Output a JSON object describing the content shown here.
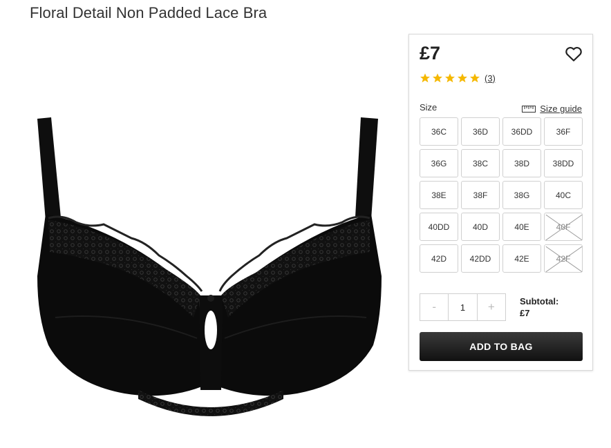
{
  "product": {
    "title": "Floral Detail Non Padded Lace Bra",
    "price": "£7",
    "rating_stars": 5,
    "review_count": "(3)"
  },
  "size": {
    "label": "Size",
    "guide_label": "Size guide",
    "options": [
      {
        "label": "36C",
        "available": true
      },
      {
        "label": "36D",
        "available": true
      },
      {
        "label": "36DD",
        "available": true
      },
      {
        "label": "36F",
        "available": true
      },
      {
        "label": "36G",
        "available": true
      },
      {
        "label": "38C",
        "available": true
      },
      {
        "label": "38D",
        "available": true
      },
      {
        "label": "38DD",
        "available": true
      },
      {
        "label": "38E",
        "available": true
      },
      {
        "label": "38F",
        "available": true
      },
      {
        "label": "38G",
        "available": true
      },
      {
        "label": "40C",
        "available": true
      },
      {
        "label": "40DD",
        "available": true
      },
      {
        "label": "40D",
        "available": true
      },
      {
        "label": "40E",
        "available": true
      },
      {
        "label": "40F",
        "available": false
      },
      {
        "label": "42D",
        "available": true
      },
      {
        "label": "42DD",
        "available": true
      },
      {
        "label": "42E",
        "available": true
      },
      {
        "label": "42F",
        "available": false
      }
    ]
  },
  "quantity": {
    "decrement": "-",
    "value": "1",
    "increment": "+"
  },
  "subtotal": {
    "label": "Subtotal:",
    "value": "£7"
  },
  "cart": {
    "add_label": "ADD TO BAG"
  },
  "colors": {
    "star": "#f5b800",
    "button_dark": "#1a1a1a"
  },
  "icons": {
    "wishlist": "heart-icon",
    "size_guide": "ruler-icon",
    "rating": "star-icon"
  }
}
